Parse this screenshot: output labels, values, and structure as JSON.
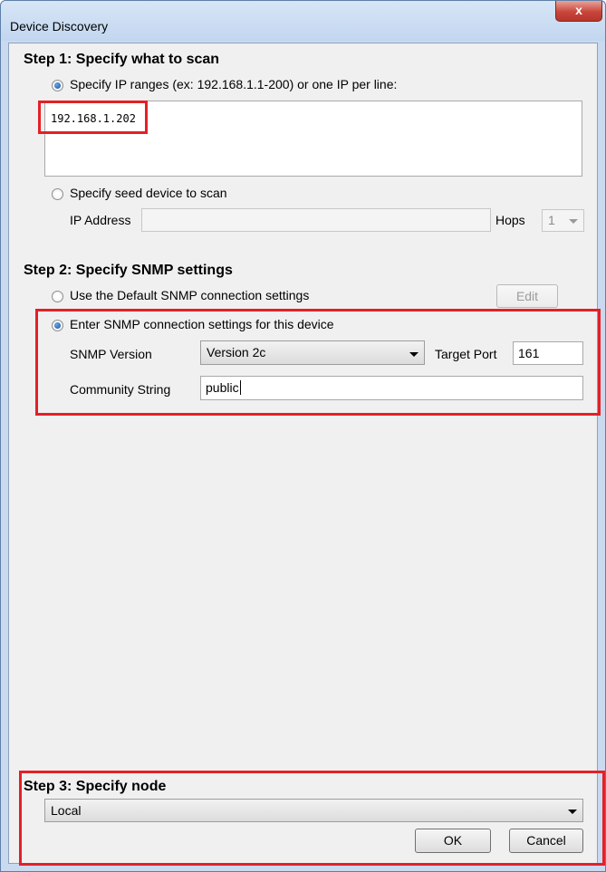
{
  "window": {
    "title": "Device Discovery",
    "close_glyph": "x"
  },
  "step1": {
    "heading": "Step 1: Specify what to scan",
    "ip_ranges_option": "Specify IP ranges (ex: 192.168.1.1-200) or one IP per line:",
    "ip_ranges_value": "192.168.1.202",
    "seed_option": "Specify seed device to scan",
    "ip_address_label": "IP Address",
    "ip_address_value": "",
    "hops_label": "Hops",
    "hops_value": "1"
  },
  "step2": {
    "heading": "Step 2: Specify SNMP settings",
    "default_option": "Use the Default SNMP connection settings",
    "edit_button": "Edit",
    "custom_option": "Enter SNMP connection settings for this device",
    "snmp_version_label": "SNMP Version",
    "snmp_version_value": "Version 2c",
    "target_port_label": "Target Port",
    "target_port_value": "161",
    "community_label": "Community String",
    "community_value": "public"
  },
  "step3": {
    "heading": "Step 3: Specify node",
    "node_value": "Local",
    "ok_button": "OK",
    "cancel_button": "Cancel"
  },
  "colors": {
    "highlight": "#e32027",
    "radio_selected": "#1b4f9b"
  }
}
